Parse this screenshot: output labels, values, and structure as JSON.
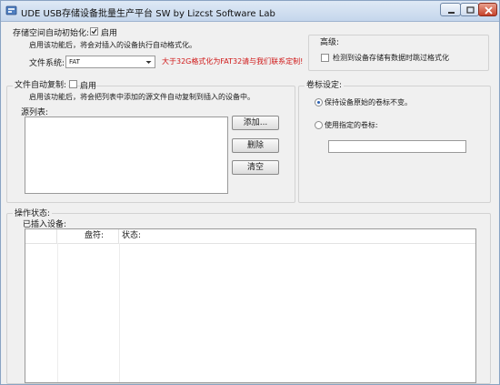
{
  "window": {
    "title": "UDE USB存储设备批量生产平台  SW    by Lizcst Software Lab"
  },
  "storage_init": {
    "label": "存储空间自动初始化:",
    "enable_label": "启用",
    "enabled": true,
    "description": "启用该功能后，将会对插入的设备执行自动格式化。",
    "fs_label": "文件系统:",
    "fs_value": "FAT",
    "fs_note": "大于32G格式化为FAT32请与我们联系定制!"
  },
  "advanced": {
    "label": "高级:",
    "check_label": "检测到设备存储有数据时跳过格式化",
    "checked": false
  },
  "file_copy": {
    "label": "文件自动复制:",
    "enable_label": "启用",
    "enabled": false,
    "description": "启用该功能后，将会把列表中添加的源文件自动复制到插入的设备中。",
    "source_list_label": "源列表:",
    "add_button": "添加...",
    "delete_button": "删除",
    "clear_button": "清空"
  },
  "volume_label": {
    "label": "卷标设定:",
    "keep_label": "保持设备原始的卷标不变。",
    "use_label": "使用指定的卷标:",
    "selected": "keep",
    "value": ""
  },
  "operation": {
    "label": "操作状态:",
    "inserted_label": "已插入设备:",
    "columns": [
      "",
      "盘符:",
      "状态:"
    ]
  },
  "colors": {
    "title_bar": "#c4d6ec",
    "accent": "#2a5fb0",
    "warning_text": "#d01818",
    "close_button": "#c6422a"
  },
  "icons": [
    "app-icon",
    "minimize-icon",
    "maximize-icon",
    "close-icon",
    "checkmark-icon",
    "dropdown-arrow-icon"
  ]
}
